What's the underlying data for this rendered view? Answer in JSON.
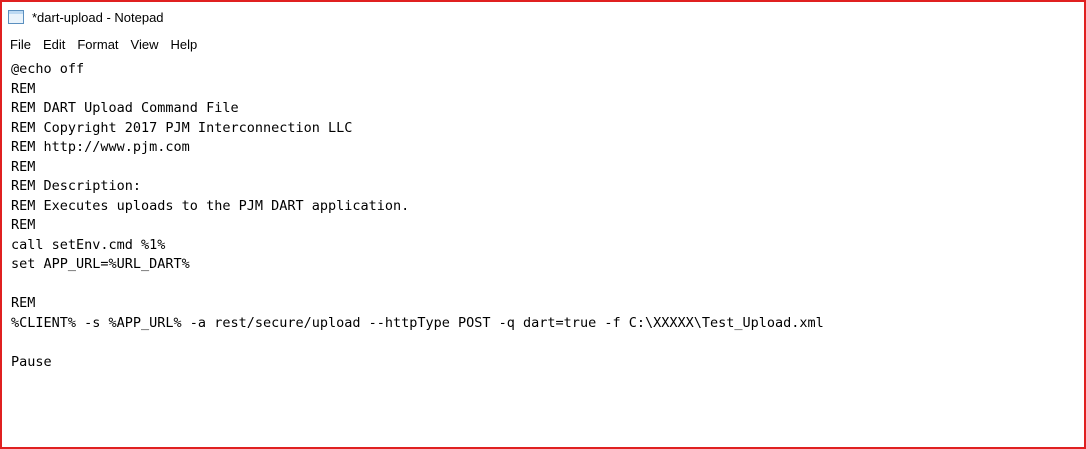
{
  "window": {
    "title": "*dart-upload - Notepad"
  },
  "menu": {
    "items": [
      "File",
      "Edit",
      "Format",
      "View",
      "Help"
    ]
  },
  "editor": {
    "lines": [
      "@echo off",
      "REM",
      "REM DART Upload Command File",
      "REM Copyright 2017 PJM Interconnection LLC",
      "REM http://www.pjm.com",
      "REM",
      "REM Description:",
      "REM Executes uploads to the PJM DART application.",
      "REM",
      "call setEnv.cmd %1%",
      "set APP_URL=%URL_DART%",
      "",
      "REM",
      "%CLIENT% -s %APP_URL% -a rest/secure/upload --httpType POST -q dart=true -f C:\\XXXXX\\Test_Upload.xml",
      "",
      "Pause"
    ]
  },
  "colors": {
    "border": "#e02020",
    "text": "#000000",
    "background": "#ffffff"
  }
}
